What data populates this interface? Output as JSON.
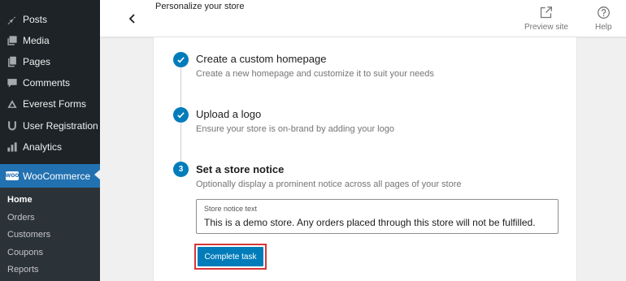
{
  "sidebar": {
    "items": [
      {
        "label": "Posts",
        "icon": "pushpin-icon"
      },
      {
        "label": "Media",
        "icon": "media-icon"
      },
      {
        "label": "Pages",
        "icon": "pages-icon"
      },
      {
        "label": "Comments",
        "icon": "comment-icon"
      },
      {
        "label": "Everest Forms",
        "icon": "everest-forms-icon"
      },
      {
        "label": "User Registration",
        "icon": "user-registration-icon"
      },
      {
        "label": "Analytics",
        "icon": "analytics-icon"
      }
    ],
    "active": {
      "label": "WooCommerce",
      "badge": "WOO",
      "color": "#2271b1"
    },
    "submenu": [
      "Home",
      "Orders",
      "Customers",
      "Coupons",
      "Reports"
    ]
  },
  "header": {
    "title": "Personalize your store",
    "preview_label": "Preview site",
    "help_label": "Help"
  },
  "steps": [
    {
      "status": "complete",
      "title": "Create a custom homepage",
      "desc": "Create a new homepage and customize it to suit your needs"
    },
    {
      "status": "complete",
      "title": "Upload a logo",
      "desc": "Ensure your store is on-brand by adding your logo"
    },
    {
      "status": "current",
      "number": "3",
      "title": "Set a store notice",
      "desc": "Optionally display a prominent notice across all pages of your store"
    }
  ],
  "notice": {
    "label": "Store notice text",
    "value": "This is a demo store. Any orders placed through this store will not be fulfilled."
  },
  "complete_button": "Complete task",
  "colors": {
    "accent": "#007cba",
    "highlight": "#d63638",
    "sidebar": "#1d2327"
  }
}
